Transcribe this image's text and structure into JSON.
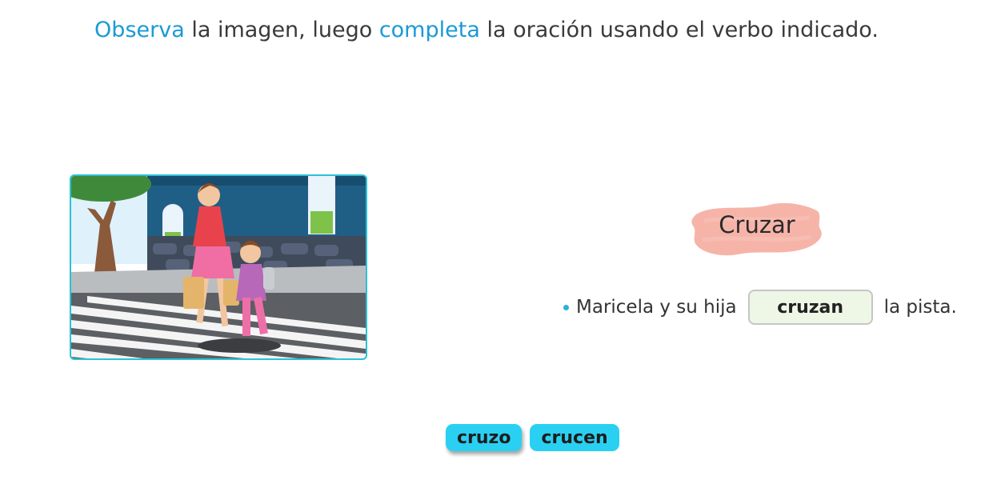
{
  "instruction": {
    "part1": "Observa",
    "part2": " la imagen, luego ",
    "part3": "completa",
    "part4": " la oración usando el verbo indicado."
  },
  "verb": {
    "label": "Cruzar"
  },
  "sentence": {
    "before": "Maricela y su hija",
    "answer": "cruzan",
    "after": "la pista."
  },
  "options": [
    "cruzo",
    "crucen"
  ],
  "colors": {
    "accent": "#1a9ad6",
    "chip": "#2ad0f2",
    "verb_brush": "#f4a79a",
    "slot_fill": "#eef7e6"
  }
}
